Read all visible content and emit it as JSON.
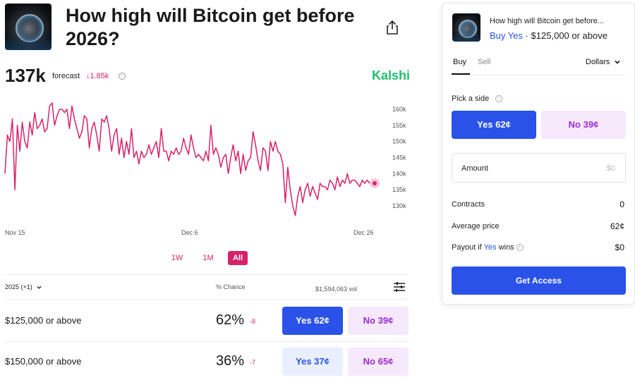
{
  "market": {
    "title": "How high will Bitcoin get before 2026?",
    "forecast_value": "137k",
    "forecast_label": "forecast",
    "forecast_change": "↓1.85k",
    "brand": "Kalshi"
  },
  "chart_data": {
    "type": "line",
    "x_ticks": [
      "Nov 15",
      "Dec 6",
      "Dec 26"
    ],
    "y_ticks": [
      "160k",
      "155k",
      "150k",
      "145k",
      "140k",
      "135k",
      "130k"
    ],
    "ylim": [
      128000,
      162000
    ],
    "color": "#d6226b",
    "series": [
      {
        "values": [
          140000,
          152000,
          150000,
          157000,
          135000,
          155000,
          147000,
          156000,
          150000,
          148000,
          156000,
          152000,
          159000,
          154000,
          155000,
          157000,
          153000,
          154000,
          161000,
          162000,
          155000,
          158000,
          160000,
          160000,
          159000,
          160000,
          154000,
          161000,
          157000,
          154000,
          151000,
          153000,
          158000,
          157000,
          148000,
          154000,
          156000,
          152000,
          147000,
          157000,
          156000,
          158000,
          154000,
          147000,
          152000,
          154000,
          146000,
          151000,
          145000,
          150000,
          146000,
          154000,
          145000,
          147000,
          143000,
          147000,
          145000,
          146000,
          149000,
          146000,
          148000,
          150000,
          145000,
          154000,
          147000,
          147000,
          144000,
          147000,
          146000,
          148000,
          146000,
          147000,
          151000,
          148000,
          146000,
          152000,
          148000,
          145000,
          146000,
          145000,
          144000,
          147000,
          144000,
          155000,
          146000,
          148000,
          146000,
          142000,
          145000,
          146000,
          140000,
          145000,
          149000,
          144000,
          147000,
          140000,
          146000,
          141000,
          144000,
          145000,
          153000,
          149000,
          144000,
          141000,
          148000,
          147000,
          141000,
          150000,
          147000,
          150000,
          147000,
          146000,
          143000,
          131000,
          142000,
          135000,
          130000,
          127000,
          133000,
          136000,
          131000,
          135000,
          137000,
          133000,
          136000,
          134000,
          132000,
          137000,
          136000,
          136000,
          135000,
          138000,
          137000,
          135000,
          139000,
          136000,
          138000,
          137000,
          140000,
          137000,
          138000,
          138000,
          137000,
          136000,
          138000,
          137000,
          138000,
          137000,
          137000,
          137000
        ]
      }
    ]
  },
  "range_buttons": {
    "w1": "1W",
    "m1": "1M",
    "all": "All"
  },
  "table": {
    "year_select": "2025 (+1)",
    "chance_header": "% Chance",
    "volume": "$1,594,063 vol",
    "rows": [
      {
        "label": "$125,000 or above",
        "chance": "62%",
        "delta": "-8",
        "yes": "Yes 62¢",
        "no": "No 39¢"
      },
      {
        "label": "$150,000 or above",
        "chance": "36%",
        "delta": "-7",
        "yes": "Yes 37¢",
        "no": "No 65¢"
      }
    ]
  },
  "card": {
    "title": "How high will Bitcoin get before...",
    "subtitle_side": "Buy Yes",
    "subtitle_rest": " · $125,000 or above",
    "tab_buy": "Buy",
    "tab_sell": "Sell",
    "currency": "Dollars",
    "pick_side": "Pick a side",
    "yes_button": "Yes 62¢",
    "no_button": "No 39¢",
    "amount_label": "Amount",
    "amount_value": "$0",
    "contracts_label": "Contracts",
    "contracts_value": "0",
    "avg_price_label": "Average price",
    "avg_price_value": "62¢",
    "payout_prefix": "Payout if ",
    "payout_side": "Yes",
    "payout_suffix": " wins",
    "payout_value": "$0",
    "get_access": "Get Access"
  },
  "icons": {
    "share": "share-icon",
    "info": "info-icon",
    "filter": "filter-sliders-icon",
    "chevron": "chevron-down-icon"
  }
}
